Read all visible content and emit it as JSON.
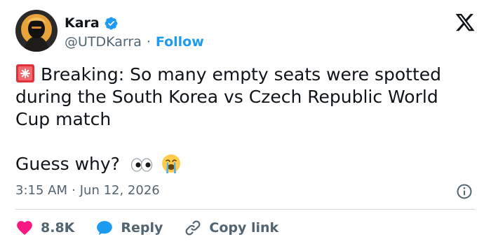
{
  "author": {
    "display_name": "Kara",
    "handle": "@UTDKarra",
    "separator": "·",
    "follow_label": "Follow",
    "verified": true
  },
  "tweet": {
    "emoji_lead": "siren",
    "line1": "Breaking: So many empty seats were spotted",
    "line2": "during the South Korea vs Czech Republic World",
    "line3": "Cup match",
    "line4": "Guess why?",
    "trailing_emojis": [
      "eyes",
      "loudly-crying-face"
    ]
  },
  "meta": {
    "time": "3:15 AM",
    "separator": "·",
    "date": "Jun 12, 2026"
  },
  "actions": {
    "likes": "8.8K",
    "reply_label": "Reply",
    "copy_label": "Copy link"
  },
  "colors": {
    "accent": "#1d9bf0",
    "like": "#f91880",
    "muted": "#536471",
    "text": "#0f1419",
    "divider": "#cfd9de"
  }
}
